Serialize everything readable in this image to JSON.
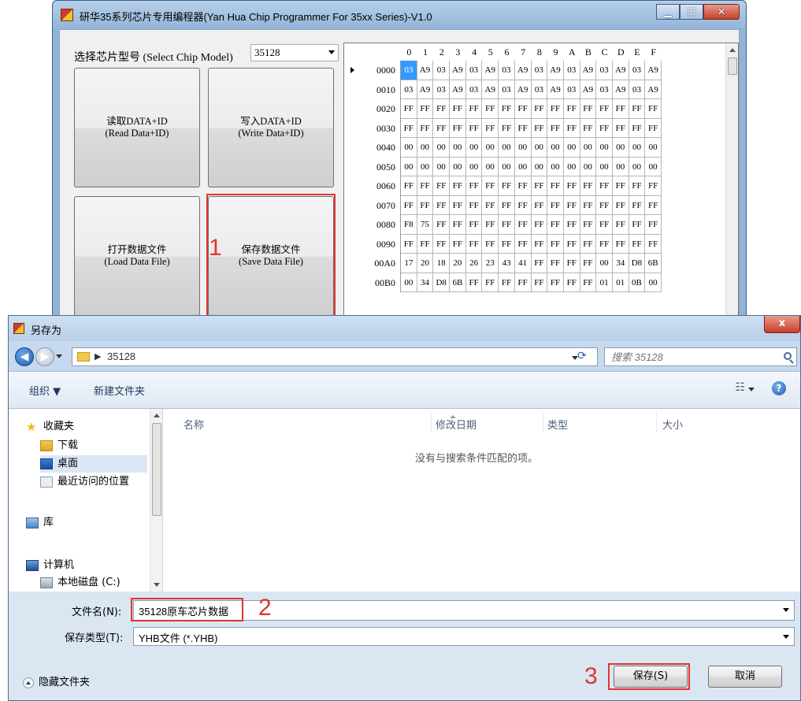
{
  "programmer": {
    "title": "研华35系列芯片专用编程器(Yan Hua Chip Programmer For 35xx Series)-V1.0",
    "model_label": "选择芯片型号 (Select Chip Model)",
    "model_value": "35128",
    "buttons": {
      "read_zh": "读取DATA+ID",
      "read_en": "(Read Data+ID)",
      "write_zh": "写入DATA+ID",
      "write_en": "(Write Data+ID)",
      "load_zh": "打开数据文件",
      "load_en": "(Load Data File)",
      "save_zh": "保存数据文件",
      "save_en": "(Save Data File)"
    },
    "hex_columns": [
      "0",
      "1",
      "2",
      "3",
      "4",
      "5",
      "6",
      "7",
      "8",
      "9",
      "A",
      "B",
      "C",
      "D",
      "E",
      "F"
    ],
    "hex_rows": [
      {
        "addr": "0000",
        "bytes": [
          "03",
          "A9",
          "03",
          "A9",
          "03",
          "A9",
          "03",
          "A9",
          "03",
          "A9",
          "03",
          "A9",
          "03",
          "A9",
          "03",
          "A9"
        ]
      },
      {
        "addr": "0010",
        "bytes": [
          "03",
          "A9",
          "03",
          "A9",
          "03",
          "A9",
          "03",
          "A9",
          "03",
          "A9",
          "03",
          "A9",
          "03",
          "A9",
          "03",
          "A9"
        ]
      },
      {
        "addr": "0020",
        "bytes": [
          "FF",
          "FF",
          "FF",
          "FF",
          "FF",
          "FF",
          "FF",
          "FF",
          "FF",
          "FF",
          "FF",
          "FF",
          "FF",
          "FF",
          "FF",
          "FF"
        ]
      },
      {
        "addr": "0030",
        "bytes": [
          "FF",
          "FF",
          "FF",
          "FF",
          "FF",
          "FF",
          "FF",
          "FF",
          "FF",
          "FF",
          "FF",
          "FF",
          "FF",
          "FF",
          "FF",
          "FF"
        ]
      },
      {
        "addr": "0040",
        "bytes": [
          "00",
          "00",
          "00",
          "00",
          "00",
          "00",
          "00",
          "00",
          "00",
          "00",
          "00",
          "00",
          "00",
          "00",
          "00",
          "00"
        ]
      },
      {
        "addr": "0050",
        "bytes": [
          "00",
          "00",
          "00",
          "00",
          "00",
          "00",
          "00",
          "00",
          "00",
          "00",
          "00",
          "00",
          "00",
          "00",
          "00",
          "00"
        ]
      },
      {
        "addr": "0060",
        "bytes": [
          "FF",
          "FF",
          "FF",
          "FF",
          "FF",
          "FF",
          "FF",
          "FF",
          "FF",
          "FF",
          "FF",
          "FF",
          "FF",
          "FF",
          "FF",
          "FF"
        ]
      },
      {
        "addr": "0070",
        "bytes": [
          "FF",
          "FF",
          "FF",
          "FF",
          "FF",
          "FF",
          "FF",
          "FF",
          "FF",
          "FF",
          "FF",
          "FF",
          "FF",
          "FF",
          "FF",
          "FF"
        ]
      },
      {
        "addr": "0080",
        "bytes": [
          "F8",
          "75",
          "FF",
          "FF",
          "FF",
          "FF",
          "FF",
          "FF",
          "FF",
          "FF",
          "FF",
          "FF",
          "FF",
          "FF",
          "FF",
          "FF"
        ]
      },
      {
        "addr": "0090",
        "bytes": [
          "FF",
          "FF",
          "FF",
          "FF",
          "FF",
          "FF",
          "FF",
          "FF",
          "FF",
          "FF",
          "FF",
          "FF",
          "FF",
          "FF",
          "FF",
          "FF"
        ]
      },
      {
        "addr": "00A0",
        "bytes": [
          "17",
          "20",
          "18",
          "20",
          "26",
          "23",
          "43",
          "41",
          "FF",
          "FF",
          "FF",
          "FF",
          "00",
          "34",
          "D8",
          "6B"
        ]
      },
      {
        "addr": "00B0",
        "bytes": [
          "00",
          "34",
          "D8",
          "6B",
          "FF",
          "FF",
          "FF",
          "FF",
          "FF",
          "FF",
          "FF",
          "FF",
          "01",
          "01",
          "0B",
          "00"
        ]
      }
    ]
  },
  "annotations": {
    "step1": "1",
    "step2": "2",
    "step3": "3"
  },
  "save_dialog": {
    "title": "另存为",
    "close_label": "x",
    "path": "35128",
    "search_placeholder": "搜索 35128",
    "toolbar": {
      "organize": "组织 ▼",
      "new_folder": "新建文件夹"
    },
    "nav": {
      "favorites": "收藏夹",
      "downloads": "下载",
      "desktop": "桌面",
      "recent": "最近访问的位置",
      "libraries": "库",
      "computer": "计算机",
      "local_disk": "本地磁盘 (C:)"
    },
    "columns": {
      "name": "名称",
      "modified": "修改日期",
      "type": "类型",
      "size": "大小"
    },
    "empty_message": "没有与搜索条件匹配的项。",
    "filename_label": "文件名(N):",
    "filename_value": "35128原车芯片数据",
    "filetype_label": "保存类型(T):",
    "filetype_value": "YHB文件 (*.YHB)",
    "hide_folders": "隐藏文件夹",
    "save_button": "保存(S)",
    "cancel_button": "取消"
  }
}
